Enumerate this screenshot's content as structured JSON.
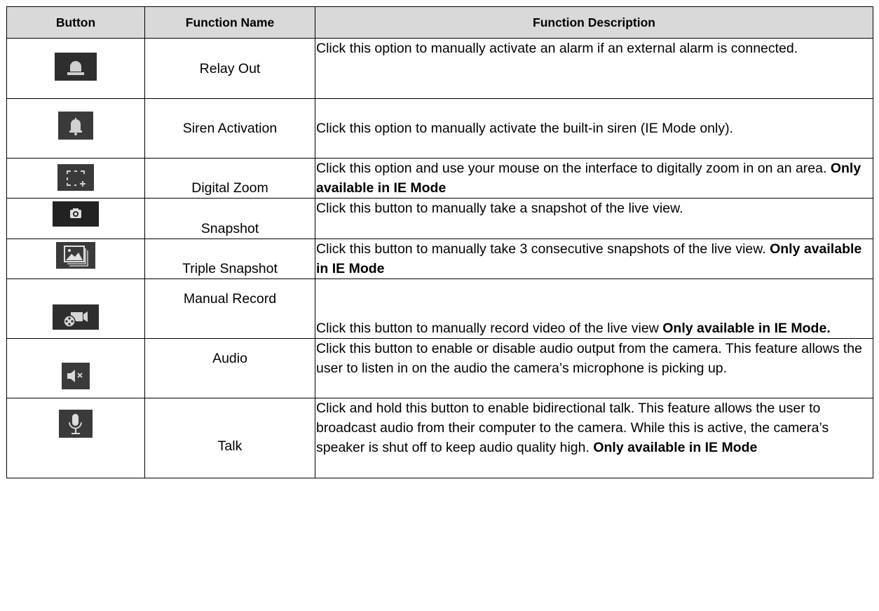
{
  "headers": {
    "button": "Button",
    "name": "Function Name",
    "desc": "Function Description"
  },
  "rows": [
    {
      "icon": "alarm-light-icon",
      "name": "Relay Out",
      "desc": "Click this option to manually activate an alarm if an external alarm is connected.",
      "bold": ""
    },
    {
      "icon": "bell-icon",
      "name": "Siren Activation",
      "desc": "Click this option to manually activate the built-in siren (IE Mode only).",
      "bold": ""
    },
    {
      "icon": "digital-zoom-icon",
      "name": "Digital Zoom",
      "desc": "Click this option and use your mouse on the interface to digitally zoom in on an area.",
      "bold": "Only available in IE Mode"
    },
    {
      "icon": "camera-icon",
      "name": "Snapshot",
      "desc": "Click this button to manually take a snapshot of the live view.",
      "bold": ""
    },
    {
      "icon": "image-stack-icon",
      "name": "Triple Snapshot",
      "desc": "Click this button to manually take 3 consecutive snapshots of the live view.",
      "bold": "Only available in IE Mode"
    },
    {
      "icon": "video-record-icon",
      "name": "Manual Record",
      "desc": "Click this button to manually record video of the live view",
      "bold": "Only available in IE Mode."
    },
    {
      "icon": "speaker-mute-icon",
      "name": "Audio",
      "desc": "Click this button to enable or disable audio output from the camera. This feature allows the user to listen in on the audio the camera’s microphone is picking up.",
      "bold": ""
    },
    {
      "icon": "microphone-icon",
      "name": "Talk",
      "desc": "Click and hold this button to enable bidirectional talk. This feature allows the user to broadcast audio from their computer to the camera. While this is active, the camera’s speaker is shut off to keep audio quality high.",
      "bold": "Only available in IE Mode"
    }
  ]
}
